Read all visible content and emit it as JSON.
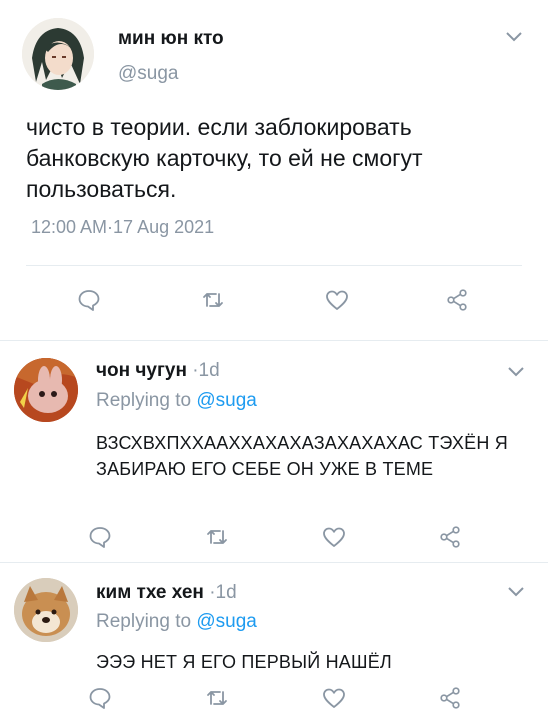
{
  "main_tweet": {
    "display_name": "мин юн кто",
    "handle": "@suga",
    "text": "чисто в теории. если заблокировать банковскую карточку, то ей не смогут пользоваться.",
    "timestamp": "12:00 AM·17 Aug 2021"
  },
  "replies": [
    {
      "display_name": "чон чугун",
      "age": "·1d",
      "replying_prefix": "Replying to",
      "replying_to": "@suga",
      "text": "ВЗСХВХПХХААХХАХАХАЗАХАХАХАС ТЭХЁН Я ЗАБИРАЮ ЕГО СЕБЕ ОН УЖЕ В ТЕМЕ"
    },
    {
      "display_name": "ким тхе хен",
      "age": "·1d",
      "replying_prefix": "Replying to",
      "replying_to": "@suga",
      "text": "ЭЭЭ НЕТ Я ЕГО ПЕРВЫЙ НАШЁЛ"
    }
  ],
  "icons": [
    "chevron-down-icon",
    "reply-icon",
    "retweet-icon",
    "like-icon",
    "share-icon"
  ],
  "colors": {
    "accent": "#1d9bf0",
    "muted": "#8a96a3",
    "text": "#14171a",
    "divider": "#e6ecf0"
  }
}
